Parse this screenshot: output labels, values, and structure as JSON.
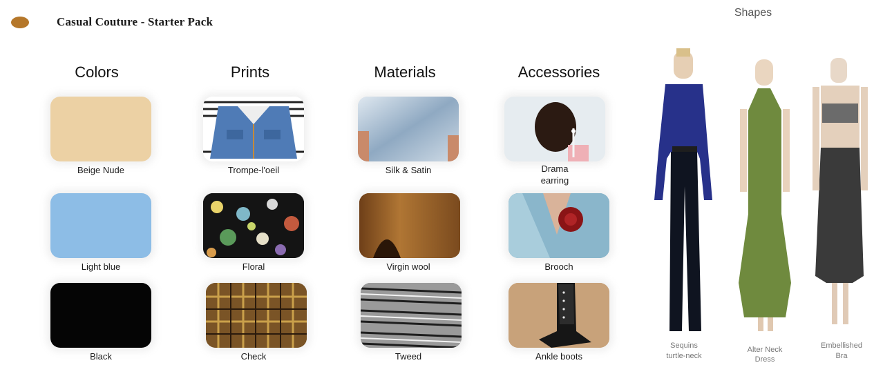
{
  "header": {
    "title": "Casual Couture - Starter Pack"
  },
  "columns": [
    "Colors",
    "Prints",
    "Materials",
    "Accessories"
  ],
  "tiles": {
    "colors": [
      {
        "label": "Beige Nude",
        "color": "#ecd1a4"
      },
      {
        "label": "Light blue",
        "color": "#8dbde6"
      },
      {
        "label": "Black",
        "color": "#050505"
      }
    ],
    "prints": [
      {
        "label": "Trompe-l'oeil",
        "icon": "denim-jacket-image"
      },
      {
        "label": "Floral",
        "icon": "floral-print-image"
      },
      {
        "label": "Check",
        "icon": "check-print-image"
      }
    ],
    "materials": [
      {
        "label": "Silk & Satin",
        "icon": "satin-fabric-image"
      },
      {
        "label": "Virgin wool",
        "icon": "wool-fabric-image"
      },
      {
        "label": "Tweed",
        "icon": "tweed-fabric-image"
      }
    ],
    "accessories": [
      {
        "label_line1": "Drama",
        "label_line2": "earring",
        "icon": "earring-image"
      },
      {
        "label": "Brooch",
        "icon": "brooch-image"
      },
      {
        "label": "Ankle boots",
        "icon": "ankle-boots-image"
      }
    ]
  },
  "shapes": {
    "title": "Shapes",
    "models": [
      {
        "line1": "Sequins",
        "line2": "turtle-neck",
        "color": "#2a3590"
      },
      {
        "line1": "Alter Neck",
        "line2": "Dress",
        "color": "#6f8a3e"
      },
      {
        "line1": "Embellished",
        "line2": "Bra",
        "color": "#3c3c3c"
      }
    ]
  }
}
